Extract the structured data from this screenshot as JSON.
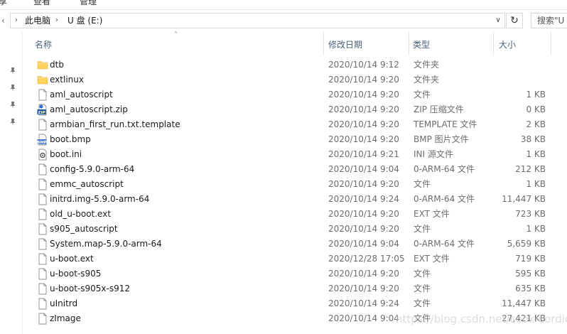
{
  "ribbon": {
    "tabs": [
      "享",
      "查看",
      "管理"
    ]
  },
  "address_bar": {
    "segments": [
      "此电脑",
      "U 盘 (E:)"
    ],
    "search_placeholder": "搜索\"U"
  },
  "columns": {
    "name": "名称",
    "date": "修改日期",
    "type": "类型",
    "size": "大小"
  },
  "files": [
    {
      "name": "dtb",
      "date": "2020/10/14 9:12",
      "type": "文件夹",
      "size": "",
      "icon": "folder-icon"
    },
    {
      "name": "extlinux",
      "date": "2020/10/14 9:20",
      "type": "文件夹",
      "size": "",
      "icon": "folder-icon"
    },
    {
      "name": "aml_autoscript",
      "date": "2020/10/14 9:20",
      "type": "文件",
      "size": "1 KB",
      "icon": "file-icon"
    },
    {
      "name": "aml_autoscript.zip",
      "date": "2020/10/14 9:20",
      "type": "ZIP 压缩文件",
      "size": "0 KB",
      "icon": "zip-icon"
    },
    {
      "name": "armbian_first_run.txt.template",
      "date": "2020/10/14 9:20",
      "type": "TEMPLATE 文件",
      "size": "2 KB",
      "icon": "file-icon"
    },
    {
      "name": "boot.bmp",
      "date": "2020/10/14 9:20",
      "type": "BMP 图片文件",
      "size": "38 KB",
      "icon": "bmp-icon"
    },
    {
      "name": "boot.ini",
      "date": "2020/10/14 9:21",
      "type": "INI 源文件",
      "size": "1 KB",
      "icon": "ini-icon"
    },
    {
      "name": "config-5.9.0-arm-64",
      "date": "2020/10/14 9:04",
      "type": "0-ARM-64 文件",
      "size": "212 KB",
      "icon": "file-icon"
    },
    {
      "name": "emmc_autoscript",
      "date": "2020/10/14 9:20",
      "type": "文件",
      "size": "1 KB",
      "icon": "file-icon"
    },
    {
      "name": "initrd.img-5.9.0-arm-64",
      "date": "2020/10/14 9:24",
      "type": "0-ARM-64 文件",
      "size": "11,447 KB",
      "icon": "file-icon"
    },
    {
      "name": "old_u-boot.ext",
      "date": "2020/10/14 9:20",
      "type": "EXT 文件",
      "size": "723 KB",
      "icon": "file-icon"
    },
    {
      "name": "s905_autoscript",
      "date": "2020/10/14 9:20",
      "type": "文件",
      "size": "1 KB",
      "icon": "file-icon"
    },
    {
      "name": "System.map-5.9.0-arm-64",
      "date": "2020/10/14 9:04",
      "type": "0-ARM-64 文件",
      "size": "5,659 KB",
      "icon": "file-icon"
    },
    {
      "name": "u-boot.ext",
      "date": "2020/12/28 17:05",
      "type": "EXT 文件",
      "size": "719 KB",
      "icon": "file-icon"
    },
    {
      "name": "u-boot-s905",
      "date": "2020/10/14 9:20",
      "type": "文件",
      "size": "595 KB",
      "icon": "file-icon"
    },
    {
      "name": "u-boot-s905x-s912",
      "date": "2020/10/14 9:20",
      "type": "文件",
      "size": "635 KB",
      "icon": "file-icon"
    },
    {
      "name": "uInitrd",
      "date": "2020/10/14 9:24",
      "type": "文件",
      "size": "11,447 KB",
      "icon": "file-icon"
    },
    {
      "name": "zImage",
      "date": "2020/10/14 9:04",
      "type": "文件",
      "size": "27,421 KB",
      "icon": "file-icon"
    }
  ],
  "watermark": "https://blog.csdn.net/cookieordion",
  "colors": {
    "folder": "#ffd35c",
    "header_text": "#4c607a",
    "meta_text": "#6d6d6d"
  }
}
